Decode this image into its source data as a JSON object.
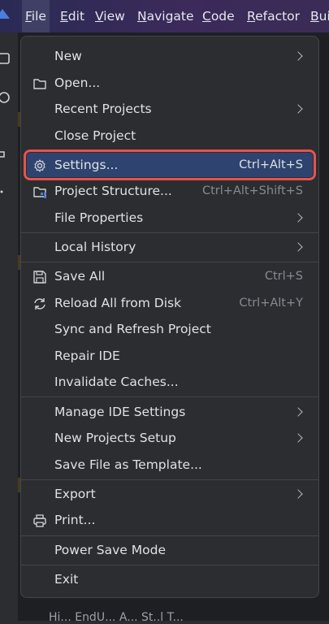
{
  "menubar": {
    "items": [
      {
        "label": "File",
        "mnemonic": "F",
        "rest": "ile",
        "active": true
      },
      {
        "label": "Edit",
        "mnemonic": "E",
        "rest": "dit"
      },
      {
        "label": "View",
        "mnemonic": "V",
        "rest": "iew"
      },
      {
        "label": "Navigate",
        "mnemonic": "N",
        "rest": "avigate"
      },
      {
        "label": "Code",
        "mnemonic": "C",
        "rest": "ode"
      },
      {
        "label": "Refactor",
        "mnemonic": "R",
        "rest": "efactor"
      },
      {
        "label": "Build",
        "mnemonic": "B",
        "rest": "ui"
      }
    ]
  },
  "menu": {
    "items": [
      {
        "id": "new",
        "label": "New",
        "submenu": true
      },
      {
        "id": "open",
        "label": "Open...",
        "icon": "folder-icon"
      },
      {
        "id": "recent-projects",
        "label": "Recent Projects",
        "submenu": true
      },
      {
        "id": "close-project",
        "label": "Close Project"
      },
      {
        "id": "settings",
        "label": "Settings...",
        "shortcut": "Ctrl+Alt+S",
        "icon": "gear-icon",
        "selected": true
      },
      {
        "id": "project-structure",
        "label": "Project Structure...",
        "shortcut": "Ctrl+Alt+Shift+S",
        "icon": "project-structure-icon"
      },
      {
        "id": "file-properties",
        "label": "File Properties",
        "submenu": true
      },
      {
        "id": "local-history",
        "label": "Local History",
        "submenu": true
      },
      {
        "id": "save-all",
        "label": "Save All",
        "shortcut": "Ctrl+S",
        "icon": "save-icon"
      },
      {
        "id": "reload-all",
        "label": "Reload All from Disk",
        "shortcut": "Ctrl+Alt+Y",
        "icon": "reload-icon"
      },
      {
        "id": "sync-refresh",
        "label": "Sync and Refresh Project"
      },
      {
        "id": "repair-ide",
        "label": "Repair IDE"
      },
      {
        "id": "invalidate-caches",
        "label": "Invalidate Caches..."
      },
      {
        "id": "manage-ide-settings",
        "label": "Manage IDE Settings",
        "submenu": true
      },
      {
        "id": "new-projects-setup",
        "label": "New Projects Setup",
        "submenu": true
      },
      {
        "id": "save-file-template",
        "label": "Save File as Template..."
      },
      {
        "id": "export",
        "label": "Export",
        "submenu": true
      },
      {
        "id": "print",
        "label": "Print...",
        "icon": "print-icon"
      },
      {
        "id": "power-save-mode",
        "label": "Power Save Mode"
      },
      {
        "id": "exit",
        "label": "Exit"
      }
    ]
  },
  "background": {
    "bottom_text": "Hi...  EndU...  A...  St..l T..."
  },
  "colors": {
    "accent_selected": "#2e436e",
    "highlight_border": "#e8524f",
    "menu_bg": "#2b2d30"
  }
}
